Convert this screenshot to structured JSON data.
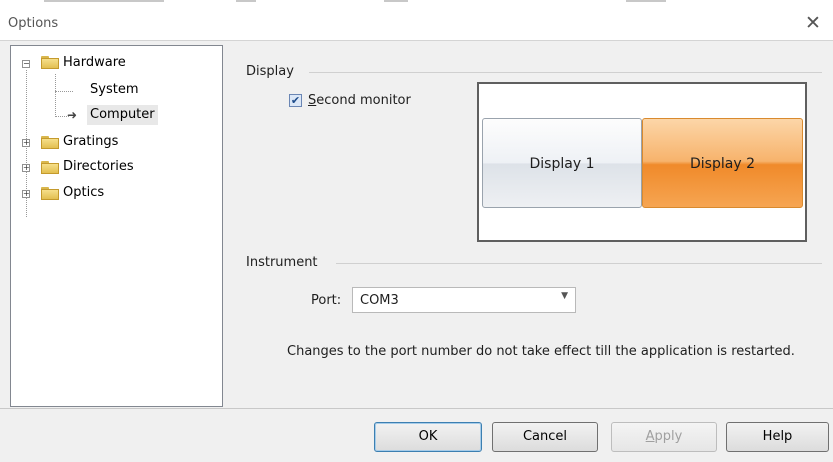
{
  "window": {
    "title": "Options"
  },
  "tree": {
    "items": [
      {
        "label": "Hardware",
        "expander": "−"
      },
      {
        "label": "System"
      },
      {
        "label": "Computer"
      },
      {
        "label": "Gratings",
        "expander": "+"
      },
      {
        "label": "Directories",
        "expander": "+"
      },
      {
        "label": "Optics",
        "expander": "+"
      }
    ]
  },
  "display": {
    "group_label": "Display",
    "second_monitor_label": "Second monitor",
    "second_monitor_checked": true,
    "display1": "Display 1",
    "display2": "Display 2"
  },
  "instrument": {
    "group_label": "Instrument",
    "port_label": "Port:",
    "port_value": "COM3",
    "note": "Changes to the port number do not take effect till the application is restarted."
  },
  "buttons": {
    "ok": "OK",
    "cancel": "Cancel",
    "apply": "Apply",
    "help": "Help"
  },
  "colors": {
    "selected_display": "#f39a3d",
    "accent": "#3c7fb1"
  }
}
